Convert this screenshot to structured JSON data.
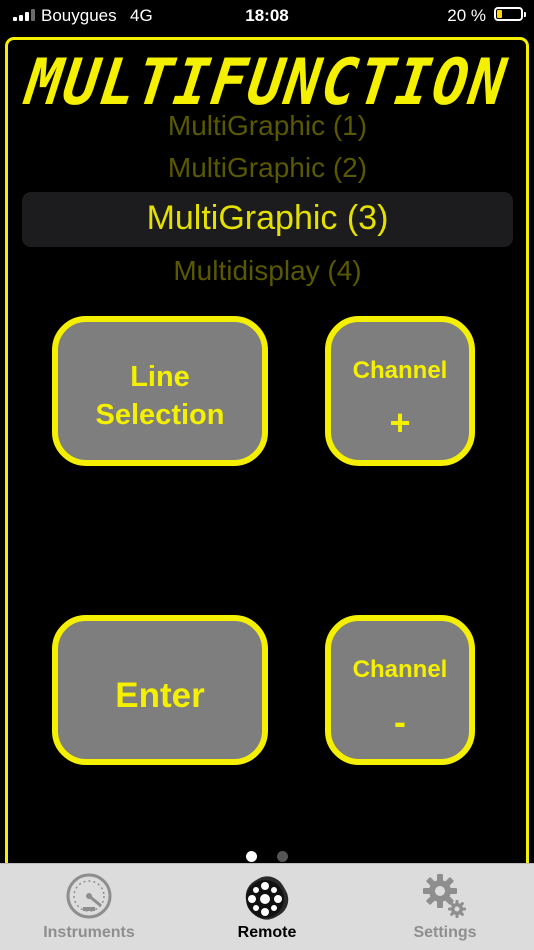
{
  "status_bar": {
    "carrier": "Bouygues",
    "network": "4G",
    "time": "18:08",
    "battery_percent_label": "20 %",
    "battery_level": 0.2,
    "signal_bars": 3
  },
  "title": "MULTIFUNCTION",
  "picker": {
    "items": [
      {
        "label": "MultiGraphic (1)"
      },
      {
        "label": "MultiGraphic (2)"
      },
      {
        "label": "MultiGraphic (3)"
      },
      {
        "label": "Multidisplay (4)"
      }
    ],
    "selected_index": 2
  },
  "buttons": {
    "line_selection": {
      "line1": "Line",
      "line2": "Selection"
    },
    "channel_plus": {
      "label": "Channel",
      "symbol": "+"
    },
    "enter": {
      "label": "Enter"
    },
    "channel_minus": {
      "label": "Channel",
      "symbol": "-"
    }
  },
  "page_dots": {
    "count": 2,
    "active": 0
  },
  "tab_bar": {
    "tabs": [
      {
        "label": "Instruments",
        "icon": "gauge-icon"
      },
      {
        "label": "Remote",
        "icon": "remote-icon",
        "active": true
      },
      {
        "label": "Settings",
        "icon": "gear-icon"
      }
    ]
  },
  "colors": {
    "accent": "#f4f000",
    "button_fill": "#7e7e7e",
    "background": "#000000",
    "tab_bar": "#dcdcdc"
  }
}
